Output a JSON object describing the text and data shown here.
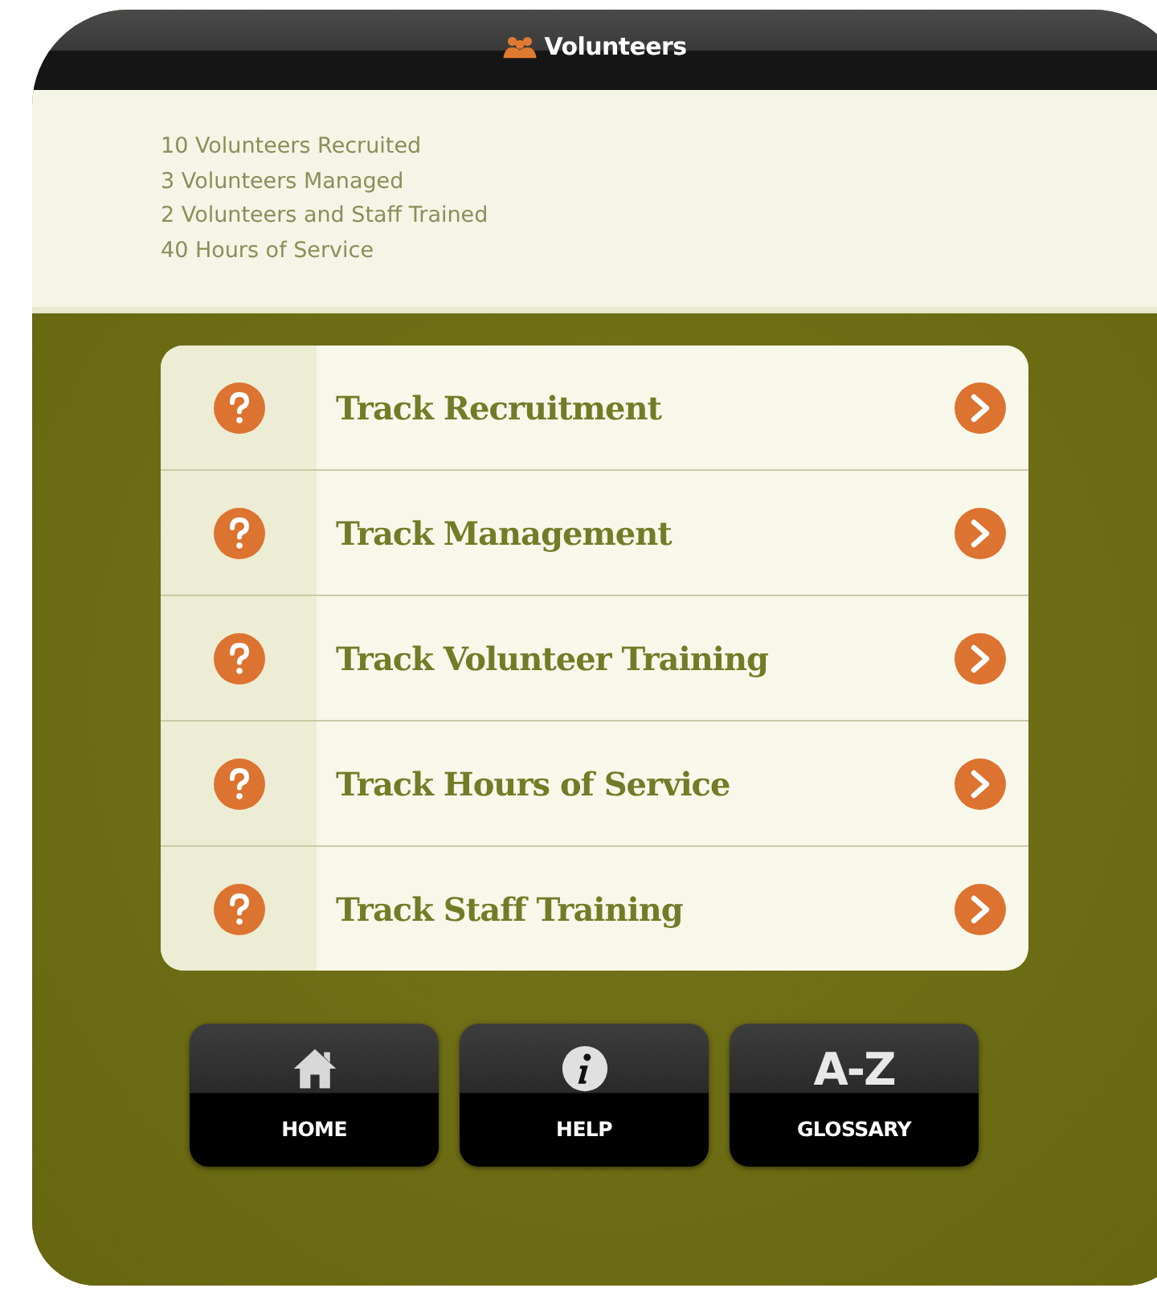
{
  "header": {
    "title": "Volunteers"
  },
  "stats": [
    "10 Volunteers Recruited",
    "3 Volunteers Managed",
    "2 Volunteers and Staff Trained",
    "40 Hours of Service"
  ],
  "menu": [
    {
      "label": "Track Recruitment"
    },
    {
      "label": "Track Management"
    },
    {
      "label": "Track Volunteer Training"
    },
    {
      "label": "Track Hours of Service"
    },
    {
      "label": "Track Staff Training"
    }
  ],
  "toolbar": [
    {
      "kind": "home",
      "label": "HOME"
    },
    {
      "kind": "help",
      "label": "HELP"
    },
    {
      "kind": "glossary",
      "glyph": "A-Z",
      "label": "GLOSSARY"
    }
  ]
}
